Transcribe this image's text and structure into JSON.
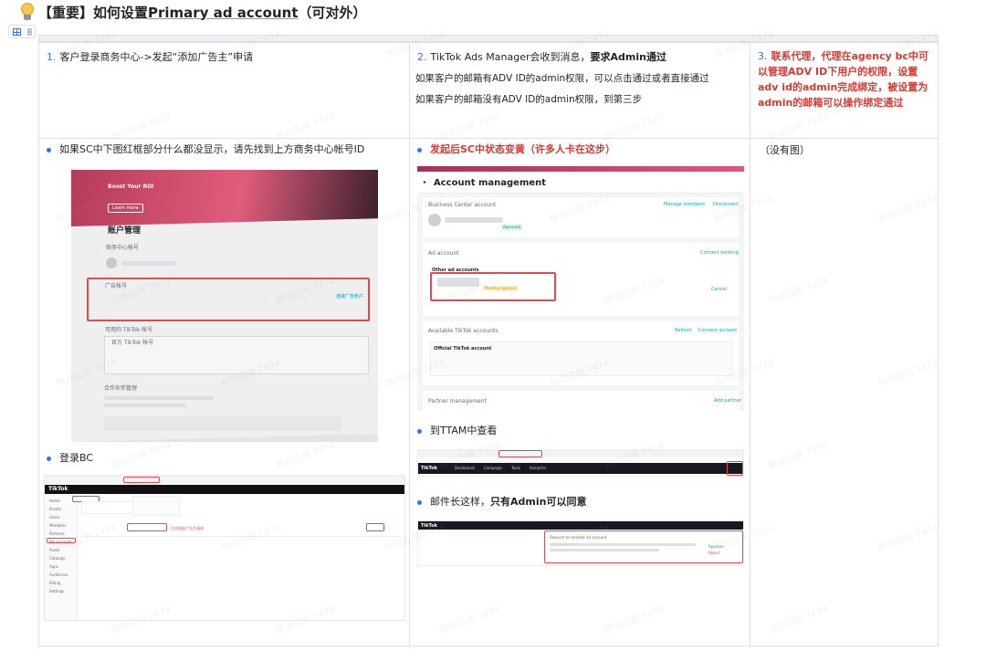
{
  "title": {
    "prefix": "【重要】如何设置",
    "underlined": "Primary ad account",
    "suffix": "（可对外）"
  },
  "toolbar": {
    "table_icon": "table-icon",
    "drag_icon": "drag-handle-icon"
  },
  "row1": {
    "c1": {
      "num": "1.",
      "text": "客户登录商务中心->发起“添加广告主”申请"
    },
    "c2": {
      "num": "2.",
      "text_a": "TikTok Ads Manager会收到消息，",
      "text_b": "要求Admin通过",
      "line2": "如果客户的邮箱有ADV ID的admin权限，可以点击通过或者直接通过",
      "line3": "如果客户的邮箱没有ADV ID的admin权限，到第三步"
    },
    "c3": {
      "num": "3.",
      "text": "联系代理，代理在agency bc中可以管理ADV ID下用户的权限，设置adv id的admin完成绑定，被设置为admin的邮箱可以操作绑定通过"
    }
  },
  "row2": {
    "c1": {
      "bullet1": "如果SC中下图红框部分什么都没显示，请先找到上方商务中心帐号ID",
      "photo": {
        "banner_title": "Boost Your ROI",
        "banner_btn": "Learn more",
        "heading": "账户管理",
        "bc_label": "商务中心帐号",
        "ad_label": "广告帐号",
        "tt_label": "可用的 TikTok 帐号",
        "official": "官方 TikTok 帐号",
        "partner": "合作伙伴管理",
        "connect": "连接广告帐户"
      },
      "bullet2": "登录BC",
      "bc_shot": {
        "brand": "TikTok",
        "note": "点击发起广告主请求",
        "sidebar": [
          "Home",
          "Assets",
          "Users",
          "Members",
          "Partners",
          "Ad accounts",
          "Pixels",
          "Catalogs",
          "Apps",
          "Audiences",
          "Billing",
          "Settings"
        ]
      }
    },
    "c2": {
      "bullet1": "发起后SC中状态变黄（许多人卡在这步）",
      "am_shot": {
        "heading": "Account management",
        "bc_label": "Business Center account",
        "manage": "Manage members",
        "disconnect": "Disconnect",
        "approved": "Approved",
        "ad_label": "Ad account",
        "connect_existing": "Connect existing",
        "other": "Other ad accounts",
        "pending": "Pending approval",
        "cancel": "Cancel",
        "tt_label": "Available TikTok accounts",
        "refresh": "Refresh",
        "connect_account": "Connect account",
        "official": "Official TikTok account",
        "partner": "Partner management",
        "add_partner": "Add partner"
      },
      "bullet2": "到TTAM中查看",
      "ttam": {
        "brand": "TikTok",
        "tabs": [
          "Dashboard",
          "Campaign",
          "Tools",
          "Analytics"
        ]
      },
      "bullet3_a": "邮件长这样，",
      "bullet3_b": "只有Admin可以同意",
      "mail": {
        "brand": "TikTok",
        "subject": "Request to connect ad account",
        "approve": "Approve",
        "reject": "Reject"
      }
    },
    "c3": {
      "text": "（没有图）"
    }
  },
  "watermark": "移动应用 7474",
  "colors": {
    "accent": "#3370ff",
    "red": "#d83931",
    "border": "#dee0e3"
  }
}
